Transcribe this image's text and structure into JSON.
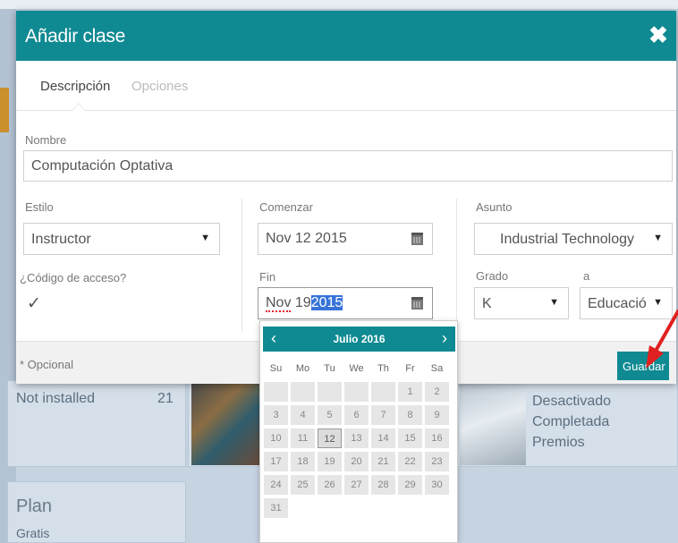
{
  "background": {
    "stat_label": "Not installed",
    "stat_value": "21",
    "status_items": [
      "Desactivado",
      "Completada",
      "Premios"
    ],
    "plan_title": "Plan",
    "plan_value": "Gratis"
  },
  "modal": {
    "title": "Añadir clase",
    "close_glyph": "✖",
    "tabs": [
      "Descripción",
      "Opciones"
    ],
    "nombre_label": "Nombre",
    "nombre_value": "Computación Optativa",
    "estilo_label": "Estilo",
    "estilo_value": "Instructor",
    "access_label": "¿Código de acceso?",
    "access_checked_glyph": "✓",
    "comenzar_label": "Comenzar",
    "comenzar_value": "Nov 12 2015",
    "fin_label": "Fin",
    "fin_month": "Nov",
    "fin_day": "19",
    "fin_year_selected": "2015",
    "asunto_label": "Asunto",
    "asunto_value": "Industrial Technology",
    "grado_label": "Grado",
    "grado_value": "K",
    "a_label": "a",
    "a_value": "Educació",
    "footer_note": "* Opcional",
    "save_label": "Guardar"
  },
  "datepicker": {
    "title": "Julio 2016",
    "prev_glyph": "‹",
    "next_glyph": "›",
    "weekdays": [
      "Su",
      "Mo",
      "Tu",
      "We",
      "Th",
      "Fr",
      "Sa"
    ],
    "weeks": [
      [
        "",
        "",
        "",
        "",
        "",
        "1",
        "2"
      ],
      [
        "3",
        "4",
        "5",
        "6",
        "7",
        "8",
        "9"
      ],
      [
        "10",
        "11",
        "12",
        "13",
        "14",
        "15",
        "16"
      ],
      [
        "17",
        "18",
        "19",
        "20",
        "21",
        "22",
        "23"
      ],
      [
        "24",
        "25",
        "26",
        "27",
        "28",
        "29",
        "30"
      ],
      [
        "31",
        "",
        "",
        "",
        "",
        "",
        ""
      ]
    ],
    "today": "12"
  },
  "colors": {
    "accent": "#108a92",
    "selection": "#3874d8",
    "annotation_arrow": "#e02020"
  }
}
